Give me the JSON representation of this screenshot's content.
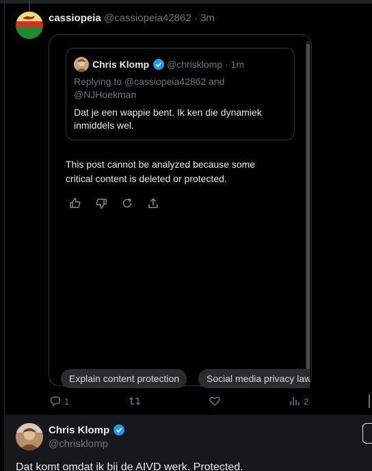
{
  "post1": {
    "display_name": "cassiopeia",
    "handle": "@cassiopeia42862",
    "separator": "·",
    "time": "3m",
    "avatar_icon": "flag-avatar-icon"
  },
  "grok_card": {
    "quoted_post": {
      "display_name": "Chris Klomp",
      "handle": "@chrisklomp",
      "separator": "·",
      "time": "1m",
      "replying": "Replying to @cassiopeia42862 and @NJHoekman",
      "text": "Dat je een wappie bent. Ik ken die dynamiek inmiddels wel."
    },
    "analysis_message": "This post cannot be analyzed because some critical content is deleted or protected.",
    "feedback_icons": [
      "thumbs-up-icon",
      "thumbs-down-icon",
      "regenerate-icon",
      "share-icon"
    ],
    "suggestions": [
      "Explain content protection",
      "Social media privacy laws"
    ]
  },
  "actions": {
    "replies": "1",
    "reposts": "",
    "likes": "",
    "views": "2"
  },
  "post2": {
    "display_name": "Chris Klomp",
    "handle": "@chrisklomp",
    "text": "Dat komt omdat ik bij de AIVD werk. Protected."
  },
  "colors": {
    "background": "#000000",
    "text": "#e7e9ea",
    "muted": "#71767b",
    "verified": "#1d9bf0",
    "chip_bg": "#2a2d30"
  }
}
